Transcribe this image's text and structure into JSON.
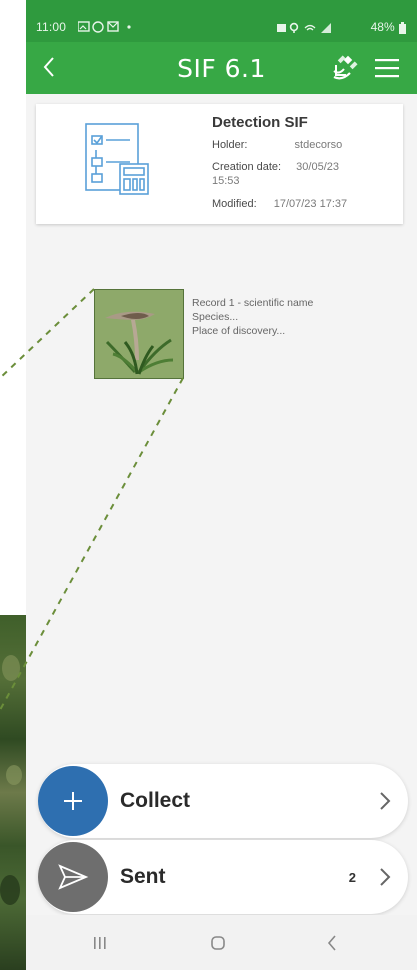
{
  "status_bar": {
    "time": "11:00",
    "battery": "48%"
  },
  "app_bar": {
    "title": "SIF 6.1",
    "icons": [
      "back-arrow-icon",
      "satellite-icon",
      "hamburger-menu-icon"
    ]
  },
  "detection_card": {
    "title": "Detection SIF",
    "holder_label": "Holder:",
    "holder_value": "stdecorso",
    "creation_label": "Creation date:",
    "creation_date": "30/05/23",
    "creation_time": "15:53",
    "modified_label": "Modified:",
    "modified_value": "17/07/23 17:37"
  },
  "record": {
    "line1": "Record 1 - scientific name",
    "line2": "Species...",
    "line3": "Place of discovery..."
  },
  "actions": {
    "collect_label": "Collect",
    "sent_label": "Sent",
    "sent_count": "2"
  },
  "colors": {
    "status_bar": "#2f9a3e",
    "app_bar": "#37a845",
    "collect_circle": "#2e6fb0",
    "sent_circle": "#6e6e6e",
    "connector": "#6b8e3a"
  }
}
